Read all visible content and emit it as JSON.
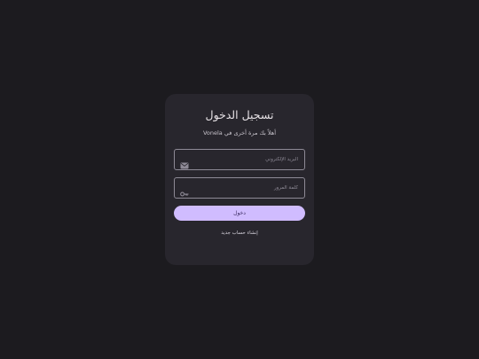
{
  "login": {
    "title": "تسجيل الدخول",
    "subtitle": "أهلاً بك مرة أخرى في Vonela",
    "email_placeholder": "البريد الإلكتروني",
    "password_placeholder": "كلمة المرور",
    "login_button": "دخول",
    "signup_link": "إنشاء حساب جديد"
  },
  "colors": {
    "background": "#1c1b1f",
    "card": "#28262d",
    "accent": "#d0bcff",
    "field_border": "#8e8a96"
  },
  "icons": {
    "email": "mail-icon",
    "password": "key-icon"
  }
}
